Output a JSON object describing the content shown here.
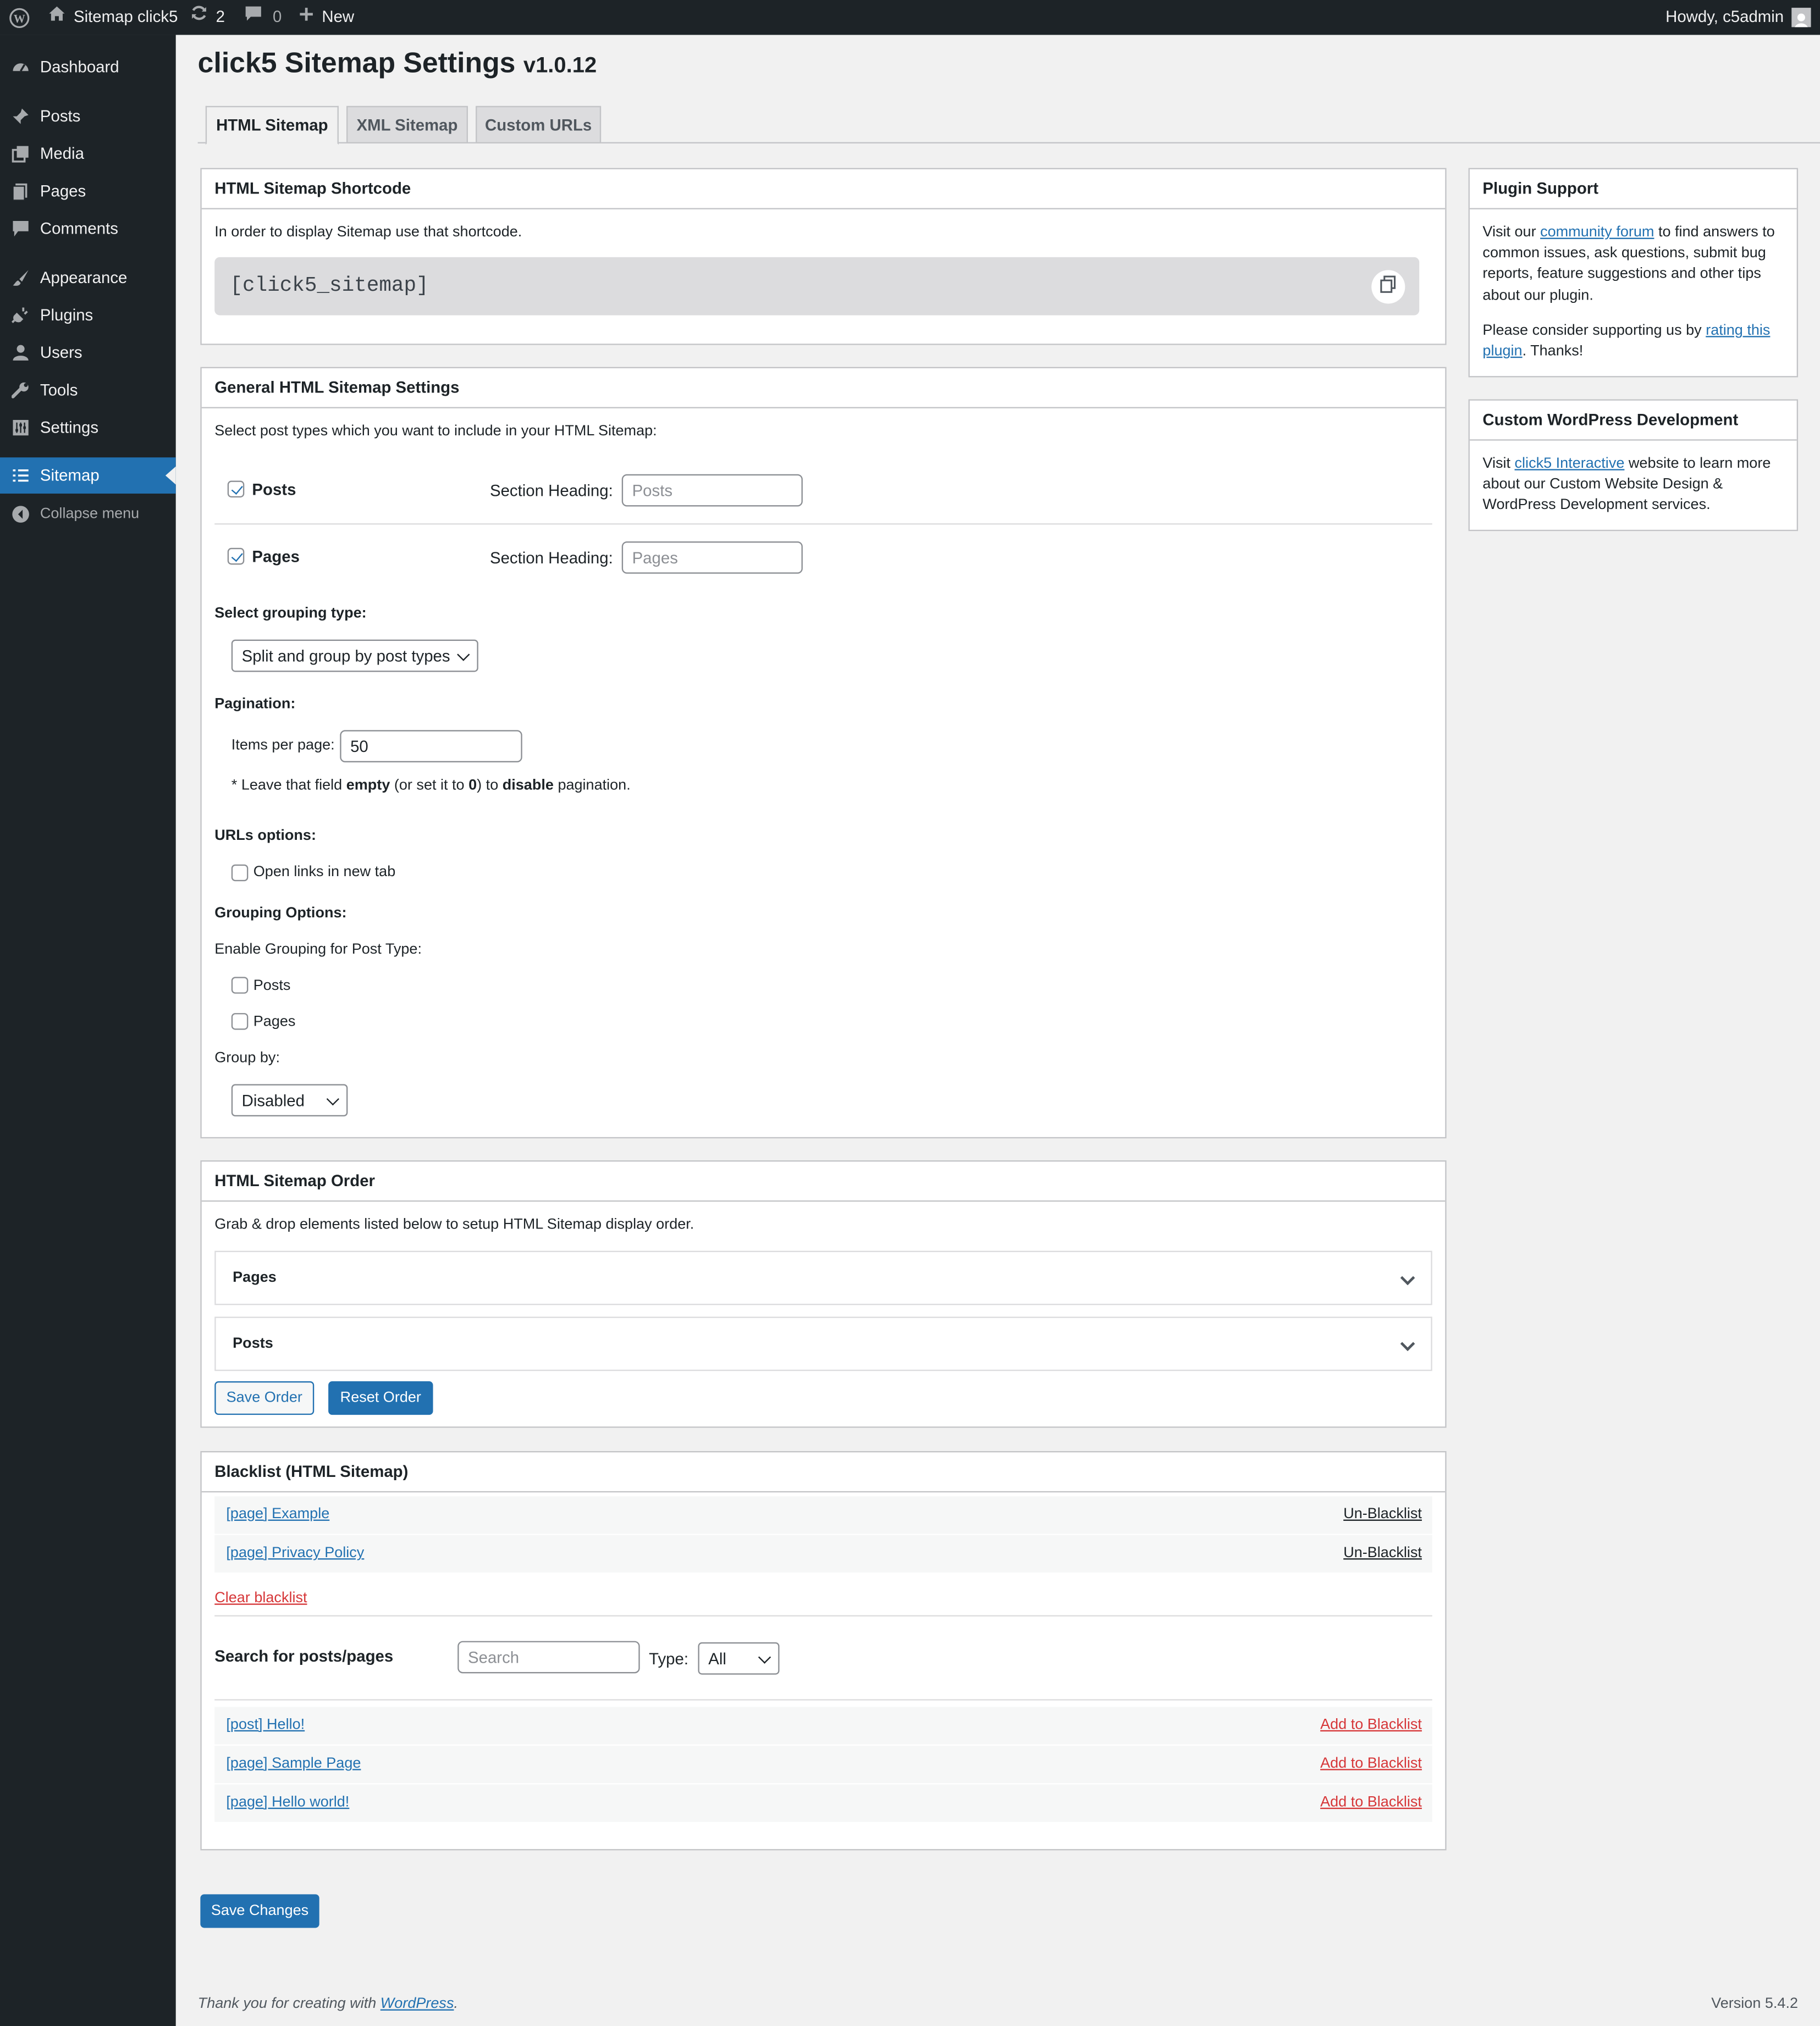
{
  "admin_bar": {
    "site_name": "Sitemap click5",
    "updates_count": "2",
    "comments_count": "0",
    "new_label": "New",
    "howdy": "Howdy, c5admin"
  },
  "sidebar": {
    "items": [
      {
        "label": "Dashboard",
        "icon": "dashboard-icon"
      },
      {
        "label": "Posts",
        "icon": "pin-icon"
      },
      {
        "label": "Media",
        "icon": "media-icon"
      },
      {
        "label": "Pages",
        "icon": "pages-icon"
      },
      {
        "label": "Comments",
        "icon": "comment-icon"
      },
      {
        "label": "Appearance",
        "icon": "brush-icon"
      },
      {
        "label": "Plugins",
        "icon": "plug-icon"
      },
      {
        "label": "Users",
        "icon": "user-icon"
      },
      {
        "label": "Tools",
        "icon": "wrench-icon"
      },
      {
        "label": "Settings",
        "icon": "sliders-icon"
      },
      {
        "label": "Sitemap",
        "icon": "list-icon",
        "current": true
      },
      {
        "label": "Collapse menu",
        "icon": "collapse-icon"
      }
    ]
  },
  "page": {
    "title": "click5 Sitemap Settings",
    "version": "v1.0.12",
    "tabs": [
      "HTML Sitemap",
      "XML Sitemap",
      "Custom URLs"
    ],
    "active_tab": "HTML Sitemap"
  },
  "shortcode_box": {
    "heading": "HTML Sitemap Shortcode",
    "intro": "In order to display Sitemap use that shortcode.",
    "shortcode": "[click5_sitemap]"
  },
  "general": {
    "heading": "General HTML Sitemap Settings",
    "intro": "Select post types which you want to include in your HTML Sitemap:",
    "post_types": [
      {
        "label": "Posts",
        "checked": true,
        "section_heading_label": "Section Heading:",
        "placeholder": "Posts"
      },
      {
        "label": "Pages",
        "checked": true,
        "section_heading_label": "Section Heading:",
        "placeholder": "Pages"
      }
    ],
    "grouping_label": "Select grouping type:",
    "grouping_value": "Split and group by post types",
    "pagination_label": "Pagination:",
    "items_per_page_label": "Items per page:",
    "items_per_page_value": "50",
    "pagination_note": {
      "a": "* Leave that field ",
      "b": "empty",
      "c": " (or set it to ",
      "d": "0",
      "e": ") to ",
      "f": "disable",
      "g": " pagination."
    },
    "urls_label": "URLs options:",
    "open_new_tab_label": "Open links in new tab",
    "grouping_options_label": "Grouping Options:",
    "enable_grouping_label": "Enable Grouping for Post Type:",
    "grouping_posts_label": "Posts",
    "grouping_pages_label": "Pages",
    "group_by_label": "Group by:",
    "group_by_value": "Disabled"
  },
  "order": {
    "heading": "HTML Sitemap Order",
    "intro": "Grab & drop elements listed below to setup HTML Sitemap display order.",
    "items": [
      "Pages",
      "Posts"
    ],
    "save_label": "Save Order",
    "reset_label": "Reset Order"
  },
  "blacklist": {
    "heading": "Blacklist (HTML Sitemap)",
    "items": [
      {
        "title": "[page] Example",
        "action": "Un-Blacklist"
      },
      {
        "title": "[page] Privacy Policy",
        "action": "Un-Blacklist"
      }
    ],
    "clear_label": "Clear blacklist",
    "search_label": "Search for posts/pages",
    "search_placeholder": "Search",
    "type_label": "Type:",
    "type_value": "All",
    "results": [
      {
        "title": "[post] Hello!",
        "action": "Add to Blacklist"
      },
      {
        "title": "[page] Sample Page",
        "action": "Add to Blacklist"
      },
      {
        "title": "[page] Hello world!",
        "action": "Add to Blacklist"
      }
    ]
  },
  "save_changes_label": "Save Changes",
  "plugin_support": {
    "heading": "Plugin Support",
    "p1_a": "Visit our ",
    "p1_link": "community forum",
    "p1_b": " to find answers to common issues, ask questions, submit bug reports, feature suggestions and other tips about our plugin.",
    "p2_a": "Please consider supporting us by ",
    "p2_link": "rating this plugin",
    "p2_b": ". Thanks!"
  },
  "custom_dev": {
    "heading": "Custom WordPress Development",
    "p_a": "Visit ",
    "p_link": "click5 Interactive",
    "p_b": " website to learn more about our Custom Website Design & WordPress Development services."
  },
  "footer": {
    "thanks_a": "Thank you for creating with ",
    "thanks_link": "WordPress",
    "thanks_b": ".",
    "version": "Version 5.4.2"
  }
}
